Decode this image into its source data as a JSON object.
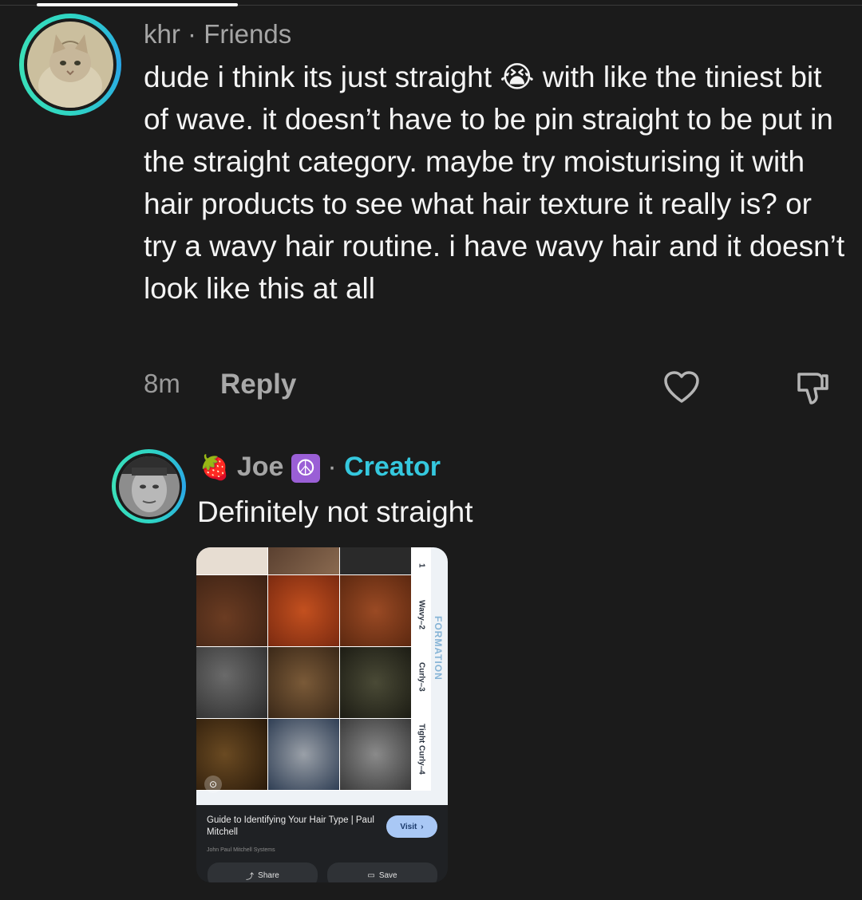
{
  "comment": {
    "username": "khr",
    "separator": "·",
    "relationship": "Friends",
    "text_part1": "dude i think its just straight",
    "emoji": "😭",
    "text_part2": " with like the tiniest bit of wave. it doesn’t have to be pin straight to be put in the straight category. maybe try moisturising it with hair products to see what hair texture it really is? or try a wavy hair routine. i have wavy hair and it doesn’t look like this at all",
    "timestamp": "8m",
    "reply_label": "Reply",
    "icons": {
      "like": "heart-icon",
      "dislike": "thumbs-down-icon"
    }
  },
  "reply": {
    "name_emoji_prefix": "🍓",
    "username": "Joe",
    "name_emoji_suffix": "☮",
    "separator": "·",
    "badge": "Creator",
    "text": "Definitely not straight",
    "attachment": {
      "strip_labels": [
        "1",
        "Wavy–2",
        "Curly–3",
        "Tight Curly–4"
      ],
      "side_label": "FORMATION",
      "title": "Guide to Identifying Your Hair Type | Paul Mitchell",
      "source": "John Paul Mitchell Systems",
      "visit_label": "Visit",
      "share_label": "Share",
      "save_label": "Save"
    }
  },
  "colors": {
    "background": "#1b1b1b",
    "ring": "#2fd6c3",
    "creator": "#35c8de",
    "muted": "#a5a5a5"
  }
}
